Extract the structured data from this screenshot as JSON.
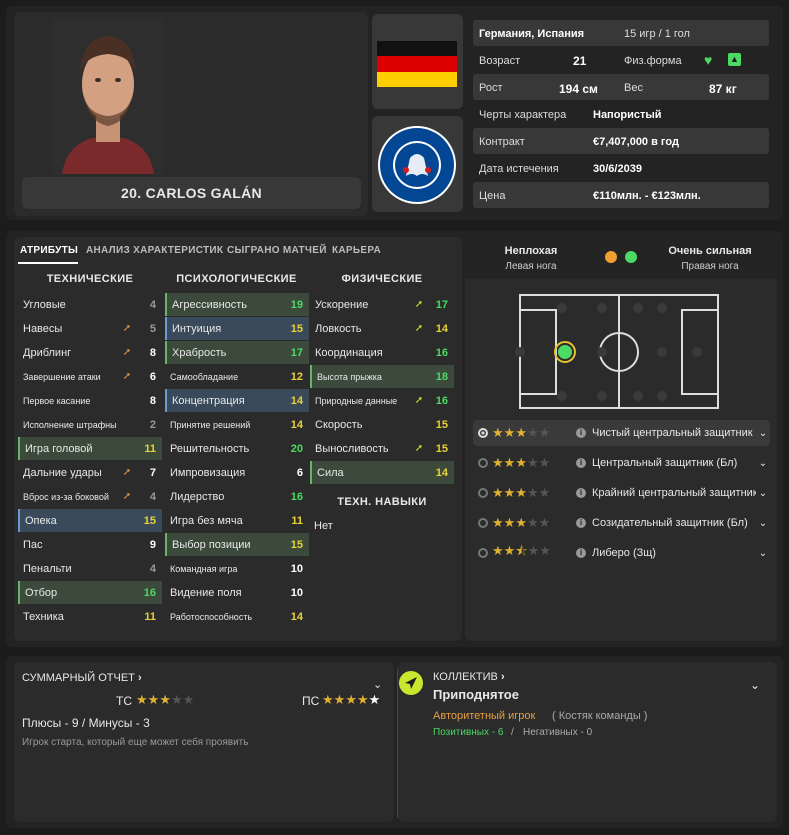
{
  "player": {
    "name": "20. CARLOS GALÁN",
    "nationality": "Германия, Испания",
    "caps": "15 игр / 1 гол",
    "age_label": "Возраст",
    "age": "21",
    "fitness_label": "Физ.форма",
    "height_label": "Рост",
    "height": "194 см",
    "weight_label": "Вес",
    "weight": "87 кг",
    "traits_label": "Черты характера",
    "traits": "Напористый",
    "contract_label": "Контракт",
    "contract": "€7,407,000 в год",
    "expiry_label": "Дата истечения",
    "expiry": "30/6/2039",
    "value_label": "Цена",
    "value": "€110млн. - €123млн."
  },
  "club_badge_text": "CHELSEA FOOTBALL CLUB",
  "tabs": [
    "АТРИБУТЫ",
    "АНАЛИЗ ХАРАКТЕРИСТИК",
    "СЫГРАНО МАТЧЕЙ",
    "КАРЬЕРА"
  ],
  "columns": {
    "technical": "ТЕХНИЧЕСКИЕ",
    "mental": "ПСИХОЛОГИЧЕСКИЕ",
    "physical": "ФИЗИЧЕСКИЕ",
    "skills": "ТЕХН. НАВЫКИ"
  },
  "technical": [
    {
      "name": "Угловые",
      "value": "4"
    },
    {
      "name": "Навесы",
      "value": "5"
    },
    {
      "name": "Дриблинг",
      "value": "8"
    },
    {
      "name": "Завершение атаки",
      "value": "6"
    },
    {
      "name": "Первое касание",
      "value": "8"
    },
    {
      "name": "Исполнение штрафных",
      "value": "2"
    },
    {
      "name": "Игра головой",
      "value": "11"
    },
    {
      "name": "Дальние удары",
      "value": "7"
    },
    {
      "name": "Вброс из-за боковой",
      "value": "4"
    },
    {
      "name": "Опека",
      "value": "15"
    },
    {
      "name": "Пас",
      "value": "9"
    },
    {
      "name": "Пенальти",
      "value": "4"
    },
    {
      "name": "Отбор",
      "value": "16"
    },
    {
      "name": "Техника",
      "value": "11"
    }
  ],
  "mental": [
    {
      "name": "Агрессивность",
      "value": "19"
    },
    {
      "name": "Интуиция",
      "value": "15"
    },
    {
      "name": "Храбрость",
      "value": "17"
    },
    {
      "name": "Самообладание",
      "value": "12"
    },
    {
      "name": "Концентрация",
      "value": "14"
    },
    {
      "name": "Принятие решений",
      "value": "14"
    },
    {
      "name": "Решительность",
      "value": "20"
    },
    {
      "name": "Импровизация",
      "value": "6"
    },
    {
      "name": "Лидерство",
      "value": "16"
    },
    {
      "name": "Игра без мяча",
      "value": "11"
    },
    {
      "name": "Выбор позиции",
      "value": "15"
    },
    {
      "name": "Командная игра",
      "value": "10"
    },
    {
      "name": "Видение поля",
      "value": "10"
    },
    {
      "name": "Работоспособность",
      "value": "14"
    }
  ],
  "physical": [
    {
      "name": "Ускорение",
      "value": "17"
    },
    {
      "name": "Ловкость",
      "value": "14"
    },
    {
      "name": "Координация",
      "value": "16"
    },
    {
      "name": "Высота прыжка",
      "value": "18"
    },
    {
      "name": "Природные данные",
      "value": "16"
    },
    {
      "name": "Скорость",
      "value": "15"
    },
    {
      "name": "Выносливость",
      "value": "15"
    },
    {
      "name": "Сила",
      "value": "14"
    }
  ],
  "skills_value": "Нет",
  "feet": {
    "left_rating": "Неплохая",
    "left_label": "Левая нога",
    "right_rating": "Очень сильная",
    "right_label": "Правая нога",
    "left_color": "#f0a030",
    "right_color": "#4cd964"
  },
  "positions": [
    {
      "name": "Чистый центральный защитник (Зщ)",
      "stars": 3
    },
    {
      "name": "Центральный защитник (Бл)",
      "stars": 3
    },
    {
      "name": "Крайний центральный защитник (Бл)",
      "stars": 3
    },
    {
      "name": "Созидательный защитник (Бл)",
      "stars": 3
    },
    {
      "name": "Либеро (Зщ)",
      "stars": 2.5
    }
  ],
  "summary": {
    "title": "СУММАРНЫЙ ОТЧЕТ",
    "ca_label": "ТС",
    "ca_stars": 3,
    "pa_label": "ПС",
    "pa_stars": 4,
    "pros_cons": "Плюсы - 9 / Минусы - 3",
    "note": "Игрок старта, который еще может себя проявить"
  },
  "squad": {
    "title": "КОЛЛЕКТИВ",
    "status": "Приподнятое",
    "role": "Авторитетный игрок",
    "group": "( Костяк команды )",
    "positive": "Позитивных - 6",
    "separator": "/",
    "negative": "Негативных - 0"
  }
}
